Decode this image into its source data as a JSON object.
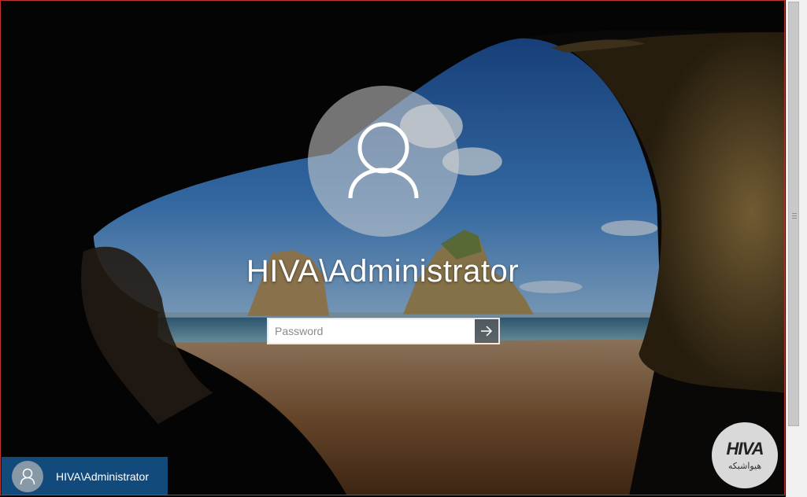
{
  "lock_screen": {
    "user_display_name": "HIVA\\Administrator",
    "password_placeholder": "Password"
  },
  "user_tile": {
    "name": "HIVA\\Administrator"
  },
  "watermark": {
    "brand": "HIVA",
    "brand_fa": "هیواشبکه"
  },
  "colors": {
    "tile_blue": "#14558c",
    "frame_red": "#c0352b"
  },
  "icons": {
    "avatar": "user-icon",
    "submit": "arrow-right-icon"
  }
}
